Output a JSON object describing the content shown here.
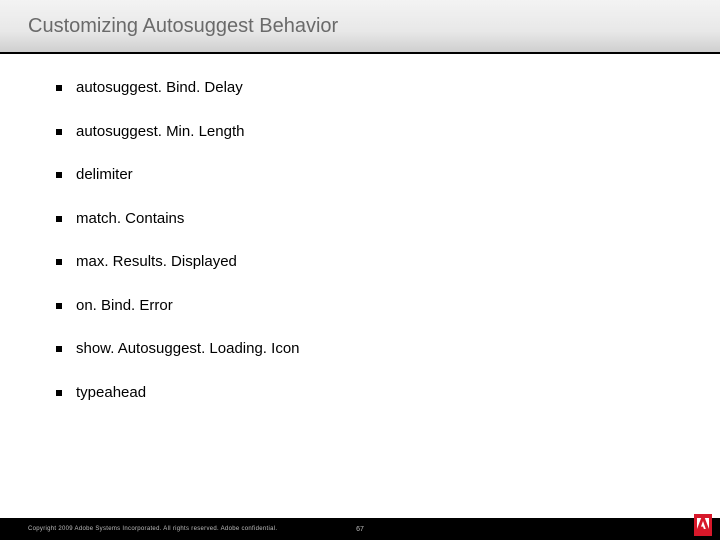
{
  "header": {
    "title": "Customizing Autosuggest Behavior"
  },
  "bullets": [
    "autosuggest. Bind. Delay",
    "autosuggest. Min. Length",
    "delimiter",
    "match. Contains",
    "max. Results. Displayed",
    "on. Bind. Error",
    "show. Autosuggest. Loading. Icon",
    "typeahead"
  ],
  "footer": {
    "copyright": "Copyright 2009 Adobe Systems Incorporated.  All rights reserved.  Adobe confidential.",
    "page": "67"
  }
}
